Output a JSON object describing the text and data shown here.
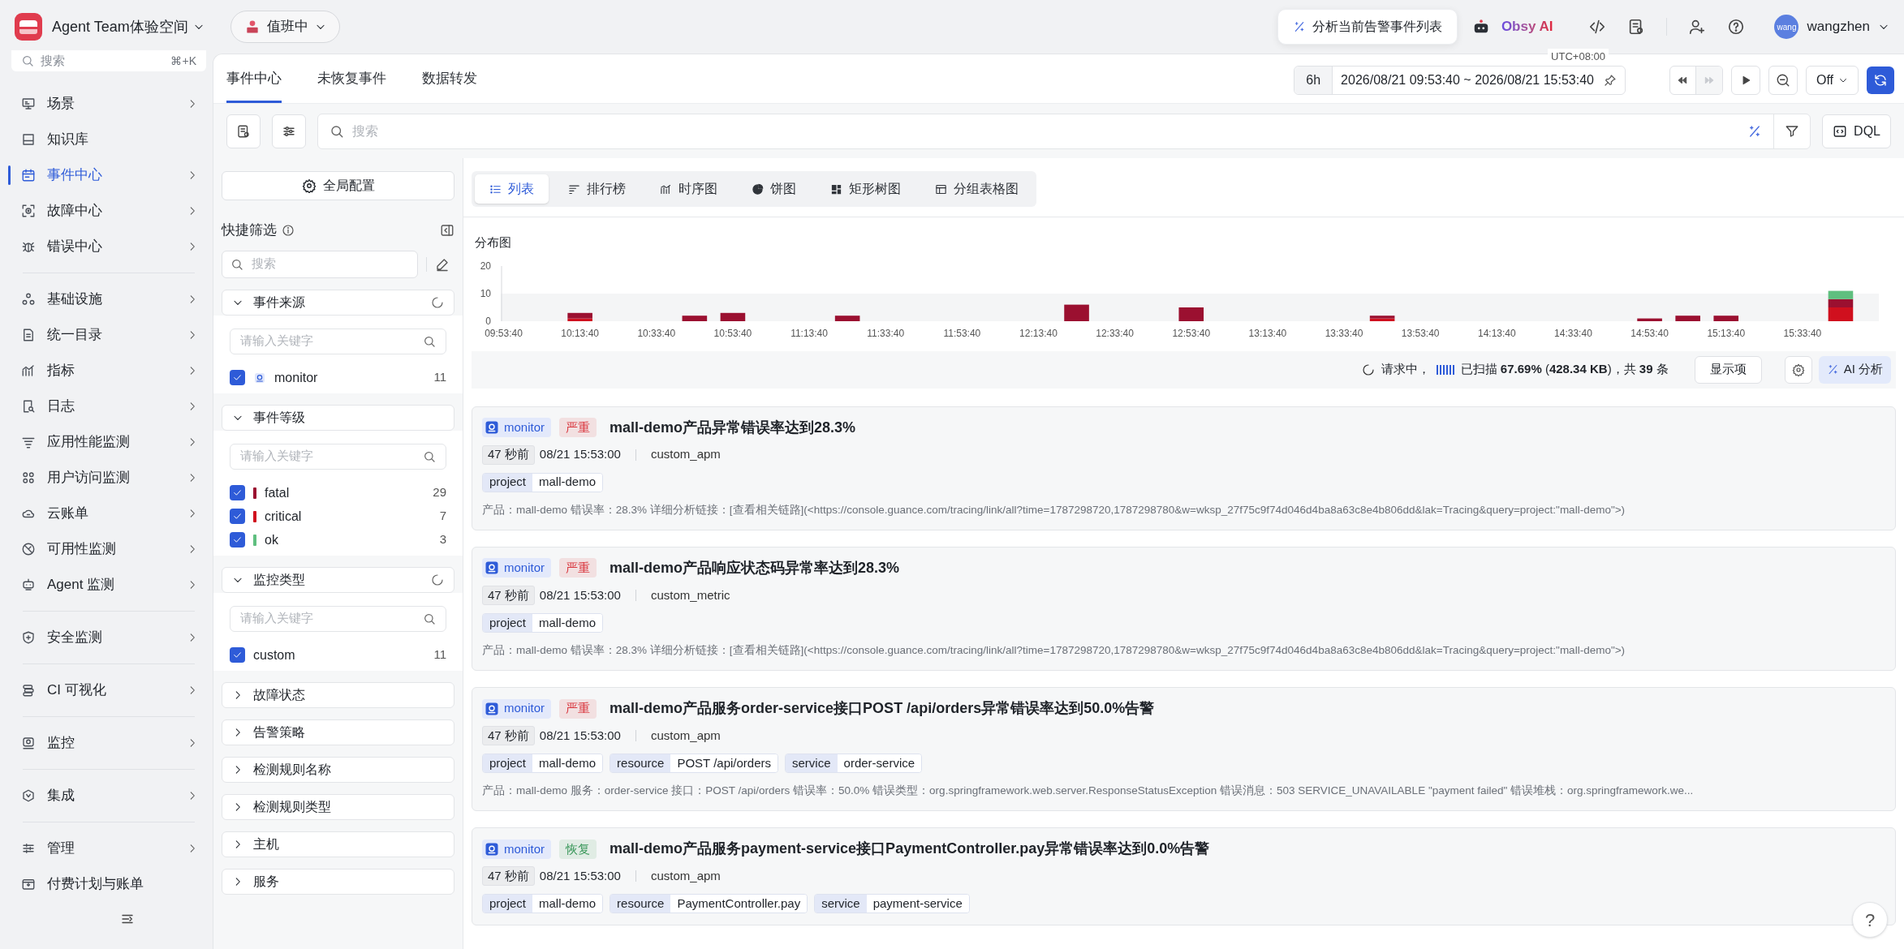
{
  "topbar": {
    "workspace": "Agent Team体验空间",
    "duty_status": "值班中",
    "ai_prompt": "分析当前告警事件列表",
    "ai_name": "Obsy AI",
    "avatar": "wang",
    "user": "wangzhen"
  },
  "sidebar": {
    "search": {
      "placeholder": "搜索",
      "shortcut": "⌘+K"
    },
    "items": [
      {
        "label": "场景",
        "submenu": true,
        "selected": false,
        "divider_before": false
      },
      {
        "label": "知识库",
        "submenu": false,
        "selected": false,
        "divider_before": false
      },
      {
        "label": "事件中心",
        "submenu": true,
        "selected": true,
        "divider_before": false
      },
      {
        "label": "故障中心",
        "submenu": true,
        "selected": false,
        "divider_before": false
      },
      {
        "label": "错误中心",
        "submenu": true,
        "selected": false,
        "divider_before": false
      },
      {
        "label": "基础设施",
        "submenu": true,
        "selected": false,
        "divider_before": true
      },
      {
        "label": "统一目录",
        "submenu": true,
        "selected": false,
        "divider_before": false
      },
      {
        "label": "指标",
        "submenu": true,
        "selected": false,
        "divider_before": false
      },
      {
        "label": "日志",
        "submenu": true,
        "selected": false,
        "divider_before": false
      },
      {
        "label": "应用性能监测",
        "submenu": true,
        "selected": false,
        "divider_before": false
      },
      {
        "label": "用户访问监测",
        "submenu": true,
        "selected": false,
        "divider_before": false
      },
      {
        "label": "云账单",
        "submenu": true,
        "selected": false,
        "divider_before": false
      },
      {
        "label": "可用性监测",
        "submenu": true,
        "selected": false,
        "divider_before": false
      },
      {
        "label": "Agent 监测",
        "submenu": true,
        "selected": false,
        "divider_before": false
      },
      {
        "label": "安全监测",
        "submenu": true,
        "selected": false,
        "divider_before": true
      },
      {
        "label": "CI 可视化",
        "submenu": true,
        "selected": false,
        "divider_before": true
      },
      {
        "label": "监控",
        "submenu": true,
        "selected": false,
        "divider_before": true
      },
      {
        "label": "集成",
        "submenu": true,
        "selected": false,
        "divider_before": true
      },
      {
        "label": "管理",
        "submenu": true,
        "selected": false,
        "divider_before": true
      },
      {
        "label": "付费计划与账单",
        "submenu": false,
        "selected": false,
        "divider_before": false
      }
    ]
  },
  "tabs": [
    {
      "label": "事件中心",
      "selected": true
    },
    {
      "label": "未恢复事件",
      "selected": false
    },
    {
      "label": "数据转发",
      "selected": false
    }
  ],
  "time": {
    "preset": "6h",
    "range": "2026/08/21 09:53:40 ~ 2026/08/21 15:53:40",
    "timezone": "UTC+08:00",
    "refresh": "Off"
  },
  "search": {
    "placeholder": "搜索",
    "dql": "DQL"
  },
  "filters": {
    "global_config": "全局配置",
    "title": "快捷筛选",
    "search_placeholder": "搜索",
    "groups": [
      {
        "label": "事件来源",
        "expanded": true,
        "loading": true,
        "placeholder": "请输入关键字",
        "options": [
          {
            "label": "monitor",
            "count": "11",
            "checked": true
          }
        ]
      },
      {
        "label": "事件等级",
        "expanded": true,
        "loading": false,
        "placeholder": "请输入关键字",
        "options": [
          {
            "label": "fatal",
            "count": "29",
            "checked": true,
            "color": "#9b1030"
          },
          {
            "label": "critical",
            "count": "7",
            "checked": true,
            "color": "#d0101e"
          },
          {
            "label": "ok",
            "count": "3",
            "checked": true,
            "color": "#5fbf7f"
          }
        ]
      },
      {
        "label": "监控类型",
        "expanded": true,
        "loading": true,
        "placeholder": "请输入关键字",
        "options": [
          {
            "label": "custom",
            "count": "11",
            "checked": true
          }
        ]
      },
      {
        "label": "故障状态",
        "expanded": false,
        "loading": false
      },
      {
        "label": "告警策略",
        "expanded": false,
        "loading": false
      },
      {
        "label": "检测规则名称",
        "expanded": false,
        "loading": false
      },
      {
        "label": "检测规则类型",
        "expanded": false,
        "loading": false
      },
      {
        "label": "主机",
        "expanded": false,
        "loading": false
      },
      {
        "label": "服务",
        "expanded": false,
        "loading": false
      }
    ]
  },
  "views": [
    {
      "label": "列表",
      "selected": true
    },
    {
      "label": "排行榜",
      "selected": false
    },
    {
      "label": "时序图",
      "selected": false
    },
    {
      "label": "饼图",
      "selected": false
    },
    {
      "label": "矩形树图",
      "selected": false
    },
    {
      "label": "分组表格图",
      "selected": false
    }
  ],
  "distribution": {
    "title": "分布图",
    "chart_data": {
      "type": "bar",
      "stacked": true,
      "ylim": [
        0,
        20
      ],
      "yticks": [
        0,
        10,
        20
      ],
      "categories": [
        "09:53:40",
        null,
        "10:13:40",
        null,
        "10:33:40",
        null,
        "10:53:40",
        null,
        "11:13:40",
        null,
        "11:33:40",
        null,
        "11:53:40",
        null,
        "12:13:40",
        null,
        "12:33:40",
        null,
        "12:53:40",
        null,
        "13:13:40",
        null,
        "13:33:40",
        null,
        "13:53:40",
        null,
        "14:13:40",
        null,
        "14:33:40",
        null,
        "14:53:40",
        null,
        "15:13:40",
        null,
        "15:33:40",
        null
      ],
      "series": [
        {
          "color": "#d0101e",
          "values": [
            0,
            0,
            1,
            0,
            0,
            0,
            0,
            0,
            0,
            0,
            0,
            0,
            0,
            0,
            0,
            0,
            0,
            0,
            0,
            0,
            0,
            0,
            0,
            1,
            0,
            0,
            0,
            0,
            0,
            0,
            0,
            0,
            0,
            0,
            0,
            5
          ]
        },
        {
          "color": "#9b1030",
          "values": [
            0,
            0,
            2,
            0,
            0,
            2,
            3,
            0,
            0,
            2,
            0,
            0,
            0,
            0,
            0,
            6,
            0,
            0,
            5,
            0,
            0,
            0,
            0,
            1,
            0,
            0,
            0,
            0,
            0,
            0,
            1,
            2,
            2,
            0,
            0,
            3
          ]
        },
        {
          "color": "#5fbf7f",
          "values": [
            0,
            0,
            0,
            0,
            0,
            0,
            0,
            0,
            0,
            0,
            0,
            0,
            0,
            0,
            0,
            0,
            0,
            0,
            0,
            0,
            0,
            0,
            0,
            0,
            0,
            0,
            0,
            0,
            0,
            0,
            0,
            0,
            0,
            0,
            0,
            3
          ]
        }
      ]
    }
  },
  "status": {
    "requesting": "请求中，",
    "scanned": "已扫描 **67.69%** (**428.34 KB**)，共 **39** 条",
    "columns_button": "显示项",
    "ai_button": "AI 分析"
  },
  "events": [
    {
      "source": "monitor",
      "color": "#d9363e",
      "severity_label": "严重",
      "title": "mall-demo产品异常错误率达到28.3%",
      "ago": "47 秒前",
      "time": "08/21 15:53:00",
      "type": "custom_apm",
      "tags": [
        {
          "key": "project",
          "value": "mall-demo"
        }
      ],
      "description": "产品：mall-demo 错误率：28.3% 详细分析链接：[查看相关链路](<https://console.guance.com/tracing/link/all?time=1787298720,1787298780&w=wksp_27f75c9f74d046d4ba8a63c8e4b806dd&lak=Tracing&query=project:\"mall-demo\">)"
    },
    {
      "source": "monitor",
      "color": "#d9363e",
      "severity_label": "严重",
      "title": "mall-demo产品响应状态码异常率达到28.3%",
      "ago": "47 秒前",
      "time": "08/21 15:53:00",
      "type": "custom_metric",
      "tags": [
        {
          "key": "project",
          "value": "mall-demo"
        }
      ],
      "description": "产品：mall-demo 错误率：28.3% 详细分析链接：[查看相关链路](<https://console.guance.com/tracing/link/all?time=1787298720,1787298780&w=wksp_27f75c9f74d046d4ba8a63c8e4b806dd&lak=Tracing&query=project:\"mall-demo\">)"
    },
    {
      "source": "monitor",
      "color": "#d9363e",
      "severity_label": "严重",
      "title": "mall-demo产品服务order-service接口POST /api/orders异常错误率达到50.0%告警",
      "ago": "47 秒前",
      "time": "08/21 15:53:00",
      "type": "custom_apm",
      "tags": [
        {
          "key": "project",
          "value": "mall-demo"
        },
        {
          "key": "resource",
          "value": "POST /api/orders"
        },
        {
          "key": "service",
          "value": "order-service"
        }
      ],
      "description": "产品：mall-demo 服务：order-service 接口：POST /api/orders 错误率：50.0% 错误类型：org.springframework.web.server.ResponseStatusException 错误消息：503 SERVICE_UNAVAILABLE \"payment failed\" 错误堆栈：org.springframework.we..."
    },
    {
      "source": "monitor",
      "color": "#3f9a5e",
      "severity_label": "恢复",
      "title": "mall-demo产品服务payment-service接口PaymentController.pay异常错误率达到0.0%告警",
      "ago": "47 秒前",
      "time": "08/21 15:53:00",
      "type": "custom_apm",
      "tags": [
        {
          "key": "project",
          "value": "mall-demo"
        },
        {
          "key": "resource",
          "value": "PaymentController.pay"
        },
        {
          "key": "service",
          "value": "payment-service"
        }
      ]
    }
  ],
  "help": "?"
}
